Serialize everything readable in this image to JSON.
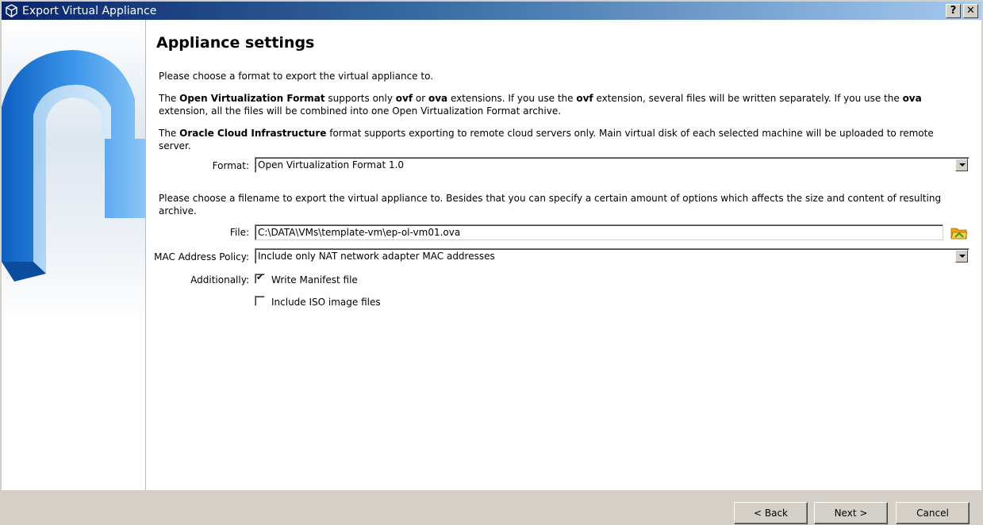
{
  "window": {
    "title": "Export Virtual Appliance",
    "help_label": "?",
    "close_label": "✕"
  },
  "page": {
    "heading": "Appliance settings",
    "intro": "Please choose a format to export the virtual appliance to.",
    "ovf_para": {
      "p1": "The ",
      "b1": "Open Virtualization Format",
      "p2": " supports only ",
      "b2": "ovf",
      "p3": " or ",
      "b3": "ova",
      "p4": " extensions. If you use the ",
      "b4": "ovf",
      "p5": " extension, several files will be written separately. If you use the ",
      "b5": "ova",
      "p6": " extension, all the files will be combined into one Open Virtualization Format archive."
    },
    "oci_para": {
      "p1": "The ",
      "b1": "Oracle Cloud Infrastructure",
      "p2": " format supports exporting to remote cloud servers only. Main virtual disk of each selected machine will be uploaded to remote server."
    },
    "filename_para": "Please choose a filename to export the virtual appliance to. Besides that you can specify a certain amount of options which affects the size and content of resulting archive."
  },
  "form": {
    "format_label": "Format:",
    "format_value": "Open Virtualization Format 1.0",
    "file_label": "File:",
    "file_value": "C:\\DATA\\VMs\\template-vm\\ep-ol-vm01.ova",
    "mac_label": "MAC Address Policy:",
    "mac_value": "Include only NAT network adapter MAC addresses",
    "additionally_label": "Additionally:",
    "manifest_label": "Write Manifest file",
    "manifest_checked": true,
    "iso_label": "Include ISO image files",
    "iso_checked": false
  },
  "buttons": {
    "back": "< Back",
    "next": "Next >",
    "cancel": "Cancel"
  },
  "icons": {
    "app": "virtualbox-cube-icon",
    "folder": "open-folder-icon",
    "wizard": "export-arrow-graphic"
  },
  "colors": {
    "title_gradient_start": "#0a246a",
    "title_gradient_end": "#a6caf0",
    "dialog_bg": "#d4d0c8"
  }
}
